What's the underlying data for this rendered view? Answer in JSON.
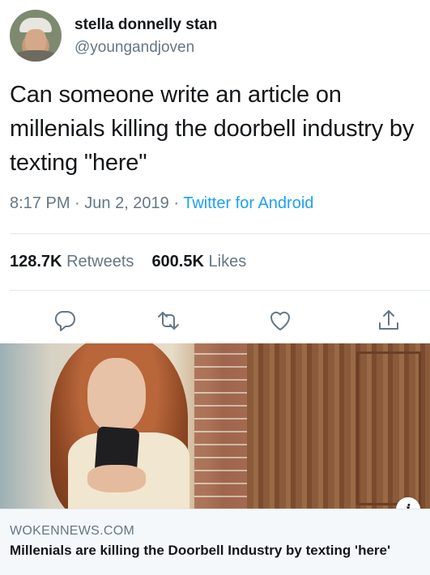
{
  "user": {
    "display_name": "stella donnelly stan",
    "handle": "@youngandjoven"
  },
  "tweet": {
    "text": "Can someone write an article on millenials killing the doorbell industry by texting \"here\"",
    "time": "8:17 PM",
    "sep1": " · ",
    "date": "Jun 2, 2019",
    "sep2": " · ",
    "source": "Twitter for Android"
  },
  "stats": {
    "retweets_count": "128.7K",
    "retweets_label": "Retweets",
    "likes_count": "600.5K",
    "likes_label": "Likes"
  },
  "actions": {
    "reply_icon": "reply-icon",
    "retweet_icon": "retweet-icon",
    "like_icon": "heart-icon",
    "share_icon": "share-icon"
  },
  "card": {
    "domain": "WOKENNEWS.COM",
    "title": "Millenials are killing the Doorbell Industry by texting 'here'",
    "info_badge": "i"
  },
  "colors": {
    "text": "#14171a",
    "secondary": "#657786",
    "link": "#1da1f2",
    "divider": "#e1e8ed",
    "card_background": "#f5f8fa"
  }
}
